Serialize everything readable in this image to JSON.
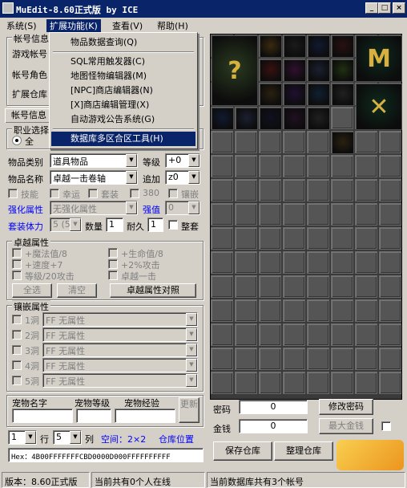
{
  "window": {
    "title": "MuEdit-8.60正式版 by ICE",
    "min": "_",
    "max": "□",
    "close": "×"
  },
  "menubar": [
    "系统(S)",
    "扩展功能(K)",
    "查看(V)",
    "帮助(H)"
  ],
  "dropdown": {
    "items": [
      "物品数据查询(Q)",
      "SQL常用触发器(C)",
      "地图怪物编辑器(M)",
      "[NPC]商店编辑器(N)",
      "[X]商店编辑管理(X)",
      "自动游戏公告系统(G)",
      "数据库多区合区工具(H)"
    ],
    "highlighted": "数据库多区合区工具(H)"
  },
  "account": {
    "title": "帐号信息",
    "rows": [
      "游戏帐号",
      "帐号角色",
      "扩展仓库"
    ],
    "tab": "帐号信息"
  },
  "job": {
    "title": "职业选择",
    "all": "全"
  },
  "item": {
    "category_label": "物品类别",
    "category": "道具物品",
    "level_label": "等级",
    "level": "+0",
    "name_label": "物品名称",
    "name": "卓越一击卷轴",
    "add_label": "追加",
    "add": "z0",
    "cb": [
      "技能",
      "幸运",
      "套装",
      "380",
      "镶嵌"
    ],
    "enh_label": "强化属性",
    "enh": "无强化属性",
    "enh_val_label": "强值",
    "enh_val": "0",
    "set_label": "套装体力",
    "set_val": "5 (5)",
    "qty_label": "数量",
    "qty": "1",
    "dur_label": "耐久",
    "dur": "1",
    "whole": "整套"
  },
  "excellent": {
    "title": "卓越属性",
    "opts": [
      "+魔法值/8",
      "+生命值/8",
      "+速度+7",
      "+2%攻击",
      "等级/20攻击",
      "卓越一击"
    ],
    "btn_all": "全选",
    "btn_clear": "清空",
    "btn_table": "卓越属性对照"
  },
  "socket": {
    "title": "镶嵌属性",
    "slots": [
      {
        "label": "1洞",
        "val": "FF 无属性"
      },
      {
        "label": "2洞",
        "val": "FF 无属性"
      },
      {
        "label": "3洞",
        "val": "FF 无属性"
      },
      {
        "label": "4洞",
        "val": "FF 无属性"
      },
      {
        "label": "5洞",
        "val": "FF 无属性"
      }
    ]
  },
  "pet": {
    "name": "宠物名字",
    "level": "宠物等级",
    "exp": "宠物经验",
    "refresh": "更新"
  },
  "position": {
    "row": "1",
    "row_label": "行",
    "col": "5",
    "col_label": "列",
    "space": "空间：2×2",
    "pos": "仓库位置"
  },
  "hex": "Hex：4B00FFFFFFFCBD0000D000FFFFFFFFFF",
  "right": {
    "pwd_label": "密码",
    "pwd": "0",
    "pwd_btn": "修改密码",
    "money_label": "金钱",
    "money": "0",
    "max_btn": "最大金钱",
    "save": "保存仓库",
    "sort": "整理仓库"
  },
  "status": {
    "version": "版本：8.60正式版",
    "online": "当前共有0个人在线",
    "accounts": "当前数据库共有3个帐号"
  },
  "colors": {
    "accent": "#0a246a",
    "face": "#d4d0c8",
    "blue_text": "#0000ff"
  }
}
